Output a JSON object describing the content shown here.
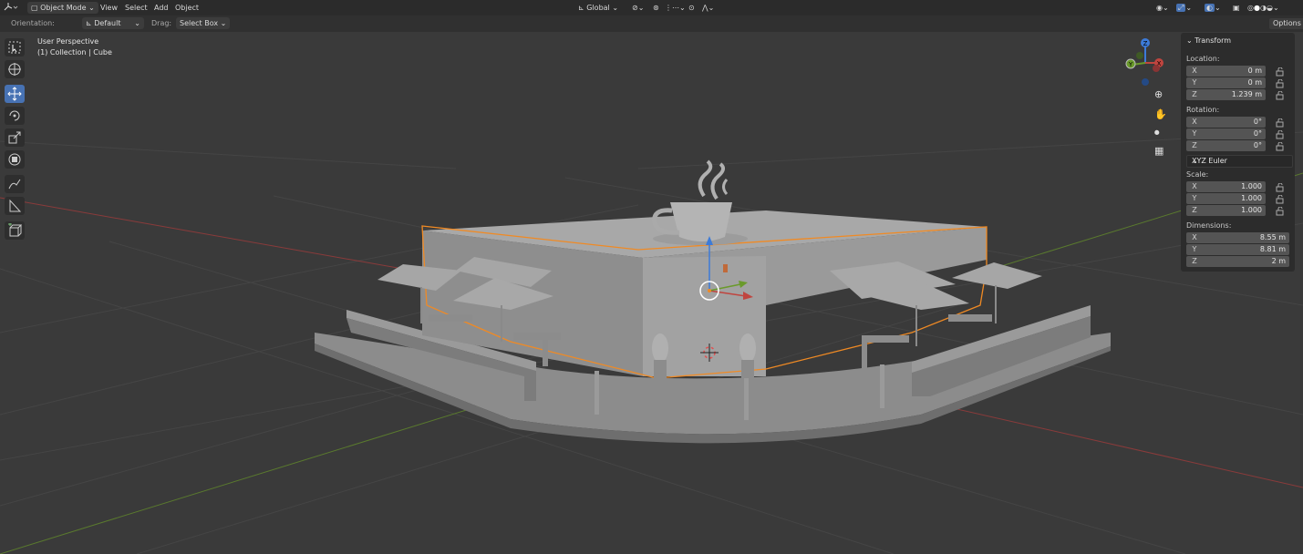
{
  "header": {
    "mode_label": "Object Mode",
    "menus": [
      "View",
      "Select",
      "Add",
      "Object"
    ],
    "transform_orientation": "Global"
  },
  "tool_options": {
    "orientation_label": "Orientation:",
    "orientation_value": "Default",
    "drag_label": "Drag:",
    "drag_value": "Select Box",
    "options_label": "Options"
  },
  "viewport": {
    "view_name": "User Perspective",
    "collection_info": "(1) Collection | Cube"
  },
  "gizmo": {
    "x": "X",
    "y": "Y",
    "z": "Z"
  },
  "transform_panel": {
    "title": "Transform",
    "location_label": "Location:",
    "location": [
      {
        "axis": "X",
        "value": "0 m"
      },
      {
        "axis": "Y",
        "value": "0 m"
      },
      {
        "axis": "Z",
        "value": "1.239 m"
      }
    ],
    "rotation_label": "Rotation:",
    "rotation": [
      {
        "axis": "X",
        "value": "0°"
      },
      {
        "axis": "Y",
        "value": "0°"
      },
      {
        "axis": "Z",
        "value": "0°"
      }
    ],
    "rotation_mode": "XYZ Euler",
    "scale_label": "Scale:",
    "scale": [
      {
        "axis": "X",
        "value": "1.000"
      },
      {
        "axis": "Y",
        "value": "1.000"
      },
      {
        "axis": "Z",
        "value": "1.000"
      }
    ],
    "dimensions_label": "Dimensions:",
    "dimensions": [
      {
        "axis": "X",
        "value": "8.55 m"
      },
      {
        "axis": "Y",
        "value": "8.81 m"
      },
      {
        "axis": "Z",
        "value": "2 m"
      }
    ]
  },
  "colors": {
    "selection_outline": "#f08a24",
    "x_axis": "#c0453f",
    "y_axis": "#6a9a2b",
    "z_axis": "#3d7bd8",
    "active_tool": "#4772b3"
  }
}
